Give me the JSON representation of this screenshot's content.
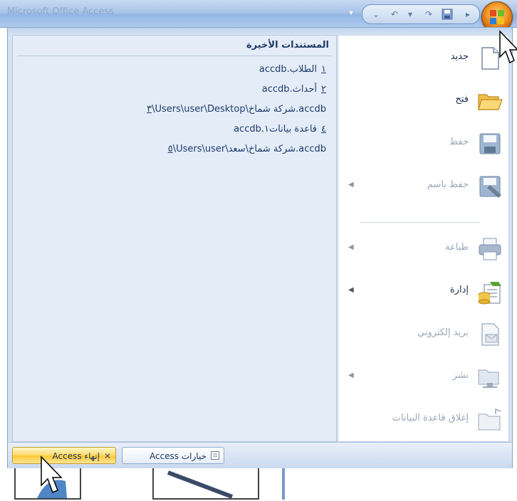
{
  "app": {
    "title": "Microsoft Office Access"
  },
  "qat": {
    "dropdown_icon": "chevron-down-icon",
    "undo_glyph": "↶",
    "redo_glyph": "↷",
    "save_glyph": "🖫",
    "office_button_icon": "office-logo-icon"
  },
  "recent": {
    "title": "المستندات الأخيرة",
    "items": [
      {
        "num": "١",
        "text": "الطلاب.accdb"
      },
      {
        "num": "٢",
        "text": "أحداث.accdb"
      },
      {
        "num": "٣",
        "text": "\\Users\\user\\Desktop\\شركة شماخ.accdb"
      },
      {
        "num": "٤",
        "text": "قاعدة بيانات١.accdb"
      },
      {
        "num": "٥",
        "text": "\\Users\\user\\شركة شماخ\\سعد.accdb"
      }
    ]
  },
  "commands": [
    {
      "label": "جديد",
      "icon": "new-document-icon",
      "enabled": true,
      "submenu": false
    },
    {
      "label": "فتح",
      "icon": "open-folder-icon",
      "enabled": true,
      "submenu": false
    },
    {
      "label": "حفظ",
      "icon": "save-disk-icon",
      "enabled": false,
      "submenu": false
    },
    {
      "label": "حفظ باسم",
      "icon": "save-as-icon",
      "enabled": false,
      "submenu": true
    },
    {
      "label": "طباعة",
      "icon": "printer-icon",
      "enabled": false,
      "submenu": true
    },
    {
      "label": "إدارة",
      "icon": "manage-database-icon",
      "enabled": true,
      "submenu": true
    },
    {
      "label": "بريد إلكتروني",
      "icon": "email-icon",
      "enabled": false,
      "submenu": false
    },
    {
      "label": "نشر",
      "icon": "publish-icon",
      "enabled": false,
      "submenu": true
    },
    {
      "label": "إغلاق قاعدة البيانات",
      "icon": "close-database-icon",
      "enabled": false,
      "submenu": false
    }
  ],
  "bottom": {
    "options_label": "خيارات Access",
    "exit_label": "إنهاء Access",
    "options_icon": "options-icon",
    "exit_icon": "close-x-icon"
  },
  "colors": {
    "accent": "#1e3a64",
    "exit_button": "#fbc932",
    "menu_background": "#d5e2f2"
  }
}
